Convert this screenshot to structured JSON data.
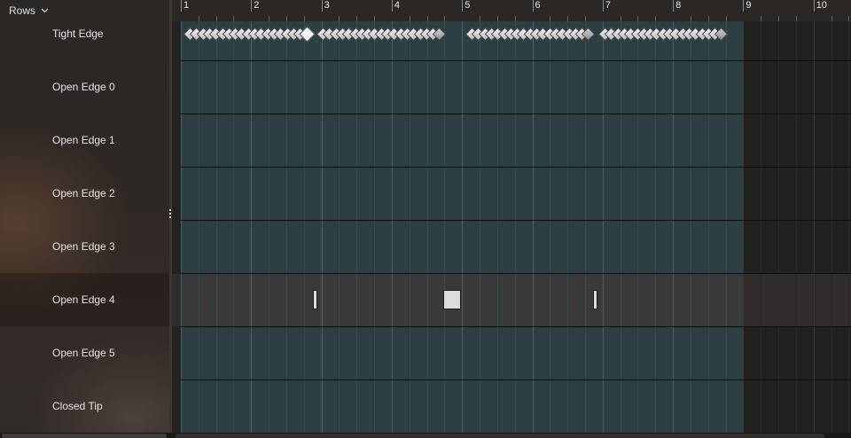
{
  "sidebar": {
    "rows_dropdown_label": "Rows",
    "rows": [
      {
        "label": "Tight Edge"
      },
      {
        "label": "Open Edge 0"
      },
      {
        "label": "Open Edge 1"
      },
      {
        "label": "Open Edge 2"
      },
      {
        "label": "Open Edge 3"
      },
      {
        "label": "Open Edge 4",
        "selected": true
      },
      {
        "label": "Open Edge 5"
      },
      {
        "label": "Closed Tip"
      }
    ]
  },
  "ruler": {
    "labels": [
      "1",
      "2",
      "3",
      "4",
      "5",
      "6",
      "7",
      "8",
      "9",
      "10"
    ]
  },
  "timeline": {
    "active_range_end_beat": 9,
    "selected_row": "Open Edge 4",
    "colors": {
      "active_range": "#2c3f42",
      "inactive_range": "#232020",
      "selected_row": "#393a3a"
    }
  },
  "icons": {
    "rows_dropdown": "chevron-down-icon",
    "keyframe": "diamond-keyframe-icon"
  }
}
